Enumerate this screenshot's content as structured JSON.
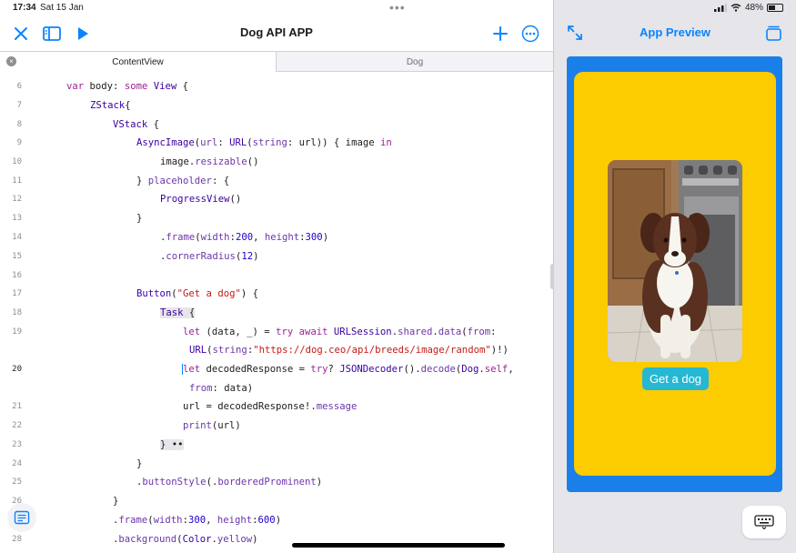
{
  "status": {
    "time": "17:34",
    "date": "Sat 15 Jan",
    "battery": "48%"
  },
  "editor": {
    "title": "Dog API APP",
    "tabs": [
      "ContentView",
      "Dog"
    ]
  },
  "code": {
    "line_numbers": [
      "6",
      "7",
      "8",
      "9",
      "10",
      "11",
      "12",
      "13",
      "14",
      "15",
      "16",
      "17",
      "18",
      "19",
      "",
      "20",
      "",
      "21",
      "22",
      "23",
      "24",
      "25",
      "26",
      "27",
      "28"
    ],
    "current_line": "20"
  },
  "preview": {
    "title": "App Preview",
    "button_label": "Get a dog"
  },
  "colors": {
    "accent": "#0a84ff",
    "preview_frame": "#1a7fe8",
    "preview_background": "#fccb00",
    "button": "#26b7d2"
  }
}
